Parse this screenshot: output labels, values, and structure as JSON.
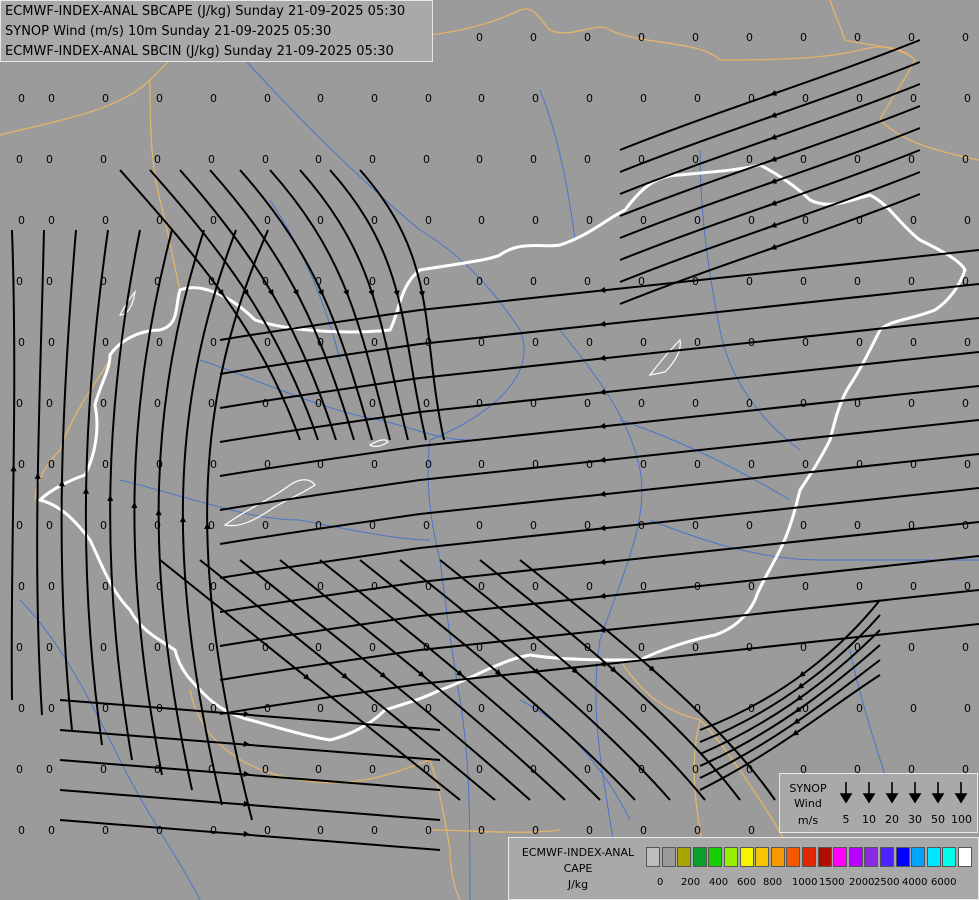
{
  "titles": [
    "ECMWF-INDEX-ANAL SBCAPE (J/kg) Sunday 21-09-2025 05:30",
    "SYNOP Wind (m/s) 10m Sunday 21-09-2025 05:30",
    "ECMWF-INDEX-ANAL SBCIN (J/kg) Sunday 21-09-2025 05:30"
  ],
  "colors": {
    "background": "#9b9b9b",
    "country_border_hungary": "#ffffff",
    "country_borders": "#e3b46a",
    "rivers": "#3c6fd0",
    "streamlines": "#000000"
  },
  "grid_value": "0",
  "wind_legend": {
    "title_lines": [
      "SYNOP",
      "Wind",
      "m/s"
    ],
    "icon": "wind-arrow-icon",
    "speeds": [
      "5",
      "10",
      "20",
      "30",
      "50",
      "100"
    ]
  },
  "cape_legend": {
    "title_lines": [
      "ECMWF-INDEX-ANAL",
      "CAPE",
      "J/kg"
    ],
    "colors": [
      "#bdbdbd",
      "#9a9a9a",
      "#a7a600",
      "#0a9f2a",
      "#19cf00",
      "#98f000",
      "#f6f400",
      "#f8c600",
      "#f79a00",
      "#f55900",
      "#e02800",
      "#b10d00",
      "#ff00ff",
      "#b800ff",
      "#8a2be2",
      "#4b23ff",
      "#0000ff",
      "#00a3ff",
      "#00e5ff",
      "#00ffe8",
      "#ffffff"
    ],
    "tick_labels": [
      "0",
      "200",
      "400",
      "600",
      "800",
      "1000",
      "1500",
      "2000",
      "2500",
      "4000",
      "6000"
    ]
  }
}
